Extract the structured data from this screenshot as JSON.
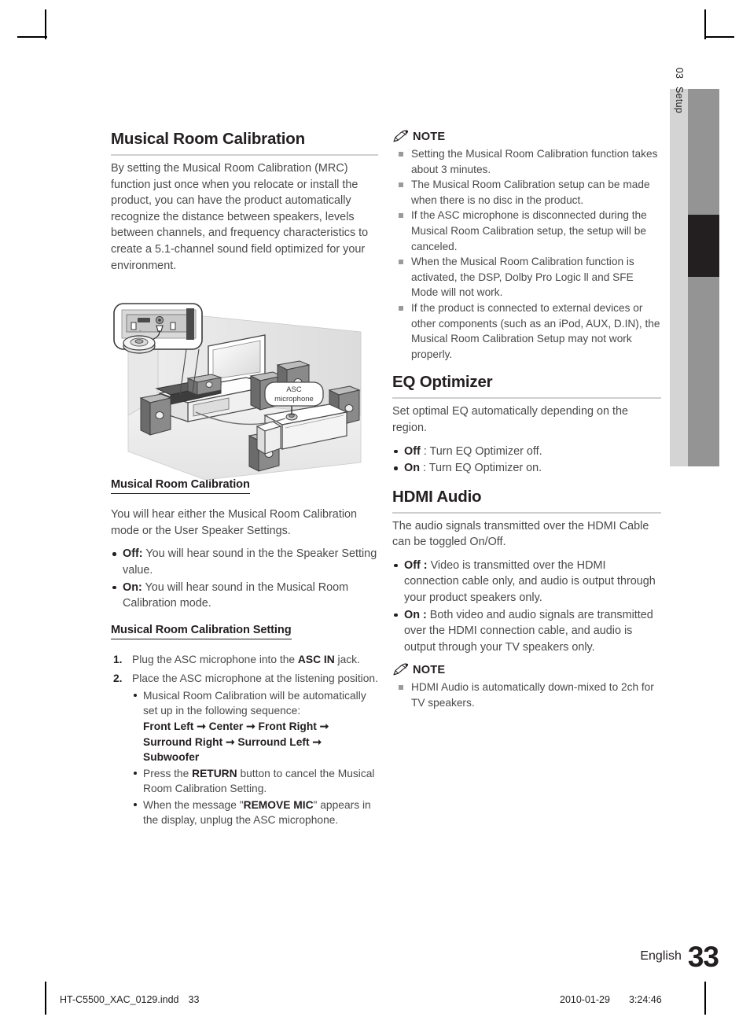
{
  "side_tab": {
    "chapter_number": "03",
    "chapter_label": "Setup"
  },
  "left_column": {
    "heading": "Musical Room Calibration",
    "intro": "By setting the Musical Room Calibration (MRC) function just once when you relocate or install the product, you can have the product automatically recognize the distance between speakers, levels between channels, and frequency characteristics to create a 5.1-channel sound field optimized for your environment.",
    "figure": {
      "callout_label_line1": "ASC",
      "callout_label_line2": "microphone"
    },
    "sub1": {
      "heading": "Musical Room Calibration",
      "intro": "You will hear either the Musical Room Calibration mode or the User Speaker Settings.",
      "bullets": [
        {
          "label": "Off:",
          "text": " You will hear sound in the the Speaker Setting value."
        },
        {
          "label": "On:",
          "text": " You will hear sound in the Musical Room Calibration mode."
        }
      ]
    },
    "sub2": {
      "heading": "Musical Room Calibration Setting",
      "steps": [
        {
          "num": "1.",
          "text_before": "Plug the ASC microphone into the ",
          "bold": "ASC IN",
          "text_after": " jack."
        },
        {
          "num": "2.",
          "text_before": "Place the ASC microphone at the listening position.",
          "bold": "",
          "text_after": ""
        }
      ],
      "sub_bullets": [
        {
          "text": "Musical Room Calibration will be automatically set up in the following sequence:",
          "sequence": "Front Left ➞ Center ➞ Front Right ➞ Surround Right ➞ Surround Left ➞ Subwoofer"
        },
        {
          "text_before": "Press the ",
          "bold": "RETURN",
          "text_after": " button to cancel the Musical Room Calibration Setting."
        },
        {
          "text_before": "When the message \"",
          "bold": "REMOVE MIC",
          "text_after": "\" appears in the display, unplug the ASC microphone."
        }
      ]
    }
  },
  "right_column": {
    "note1": {
      "icon": "pencil-icon",
      "label": "NOTE",
      "items": [
        "Setting the Musical Room Calibration function takes about 3 minutes.",
        "The Musical Room Calibration setup can be made when there is no disc in the product.",
        "If the ASC microphone is disconnected during the Musical Room Calibration setup, the setup will be canceled.",
        "When the Musical Room Calibration function is activated, the DSP, Dolby Pro Logic ll and SFE Mode will not work.",
        "If the product is connected to external devices or other components (such as an iPod, AUX, D.IN), the Musical Room Calibration Setup may not work properly."
      ]
    },
    "eq_optimizer": {
      "heading": "EQ Optimizer",
      "intro": "Set optimal EQ automatically depending on the region.",
      "bullets": [
        {
          "label": "Off",
          "text": " : Turn EQ Optimizer off."
        },
        {
          "label": "On",
          "text": " : Turn EQ Optimizer on."
        }
      ]
    },
    "hdmi_audio": {
      "heading": "HDMI Audio",
      "intro": "The audio signals transmitted over the HDMI Cable can be toggled On/Off.",
      "bullets": [
        {
          "label": "Off :",
          "text": " Video is transmitted over the HDMI connection cable only, and audio is output through your product speakers only."
        },
        {
          "label": "On :",
          "text": " Both video and audio signals are transmitted over the HDMI connection cable, and audio is output through your TV speakers only."
        }
      ]
    },
    "note2": {
      "icon": "pencil-icon",
      "label": "NOTE",
      "items": [
        "HDMI Audio is automatically down-mixed to 2ch for TV speakers."
      ]
    }
  },
  "footer": {
    "language": "English",
    "page_number": "33",
    "print_file": "HT-C5500_XAC_0129.indd",
    "print_page": "33",
    "print_date": "2010-01-29",
    "print_time": "3:24:46"
  }
}
